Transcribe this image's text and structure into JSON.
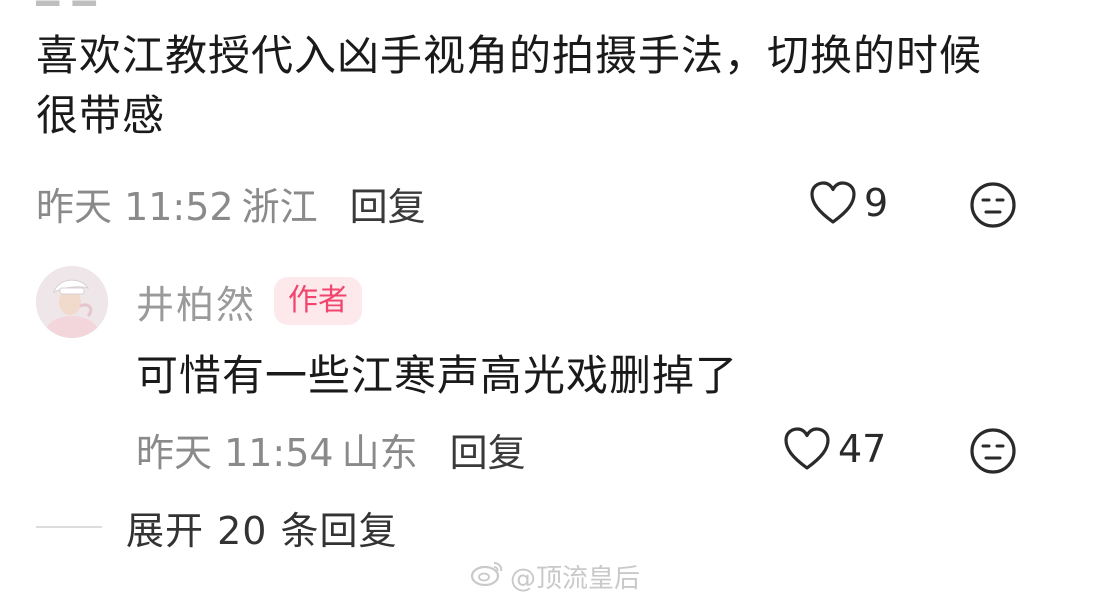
{
  "top_comment": {
    "text": "喜欢江教授代入凶手视角的拍摄手法，切换的时候很带感",
    "time": "昨天 11:52",
    "location": "浙江",
    "reply_label": "回复",
    "like_count": "9"
  },
  "reply": {
    "author": "井柏然",
    "badge": "作者",
    "text": "可惜有一些江寒声高光戏删掉了",
    "time": "昨天 11:54",
    "location": "山东",
    "reply_label": "回复",
    "like_count": "47"
  },
  "expand": {
    "label": "展开 20 条回复"
  },
  "watermark": {
    "text": "@顶流皇后"
  },
  "colors": {
    "badge_bg": "#fde8ec",
    "badge_text": "#f0456c",
    "meta_text": "#8a8a8a",
    "body_text": "#1a1a1a"
  }
}
